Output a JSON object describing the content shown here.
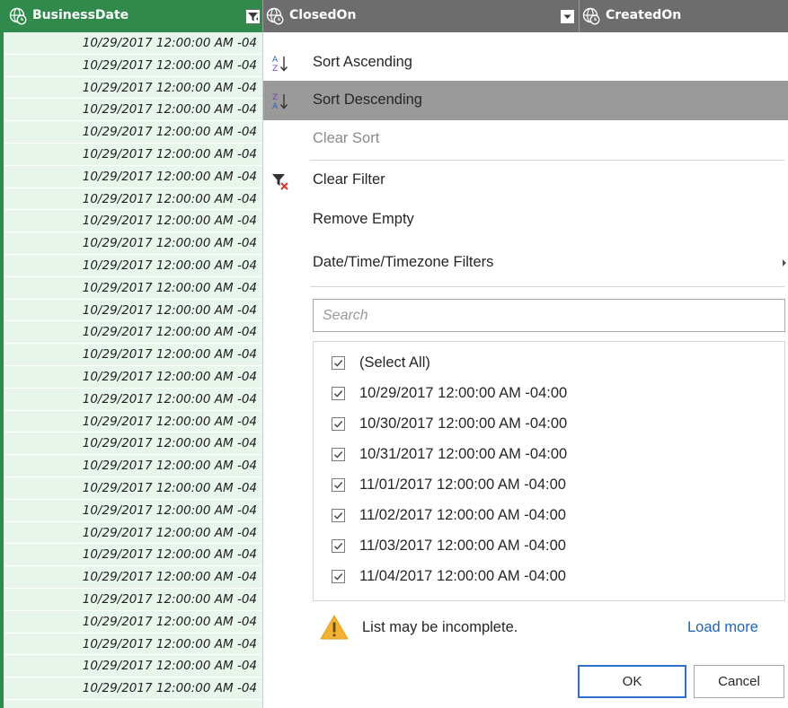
{
  "header": {
    "columns": [
      {
        "label": "BusinessDate",
        "icon": "globe-clock-icon"
      },
      {
        "label": "ClosedOn",
        "icon": "globe-clock-icon"
      },
      {
        "label": "CreatedOn",
        "icon": "globe-clock-icon"
      }
    ]
  },
  "column_values": [
    "10/29/2017 12:00:00 AM -04",
    "10/29/2017 12:00:00 AM -04",
    "10/29/2017 12:00:00 AM -04",
    "10/29/2017 12:00:00 AM -04",
    "10/29/2017 12:00:00 AM -04",
    "10/29/2017 12:00:00 AM -04",
    "10/29/2017 12:00:00 AM -04",
    "10/29/2017 12:00:00 AM -04",
    "10/29/2017 12:00:00 AM -04",
    "10/29/2017 12:00:00 AM -04",
    "10/29/2017 12:00:00 AM -04",
    "10/29/2017 12:00:00 AM -04",
    "10/29/2017 12:00:00 AM -04",
    "10/29/2017 12:00:00 AM -04",
    "10/29/2017 12:00:00 AM -04",
    "10/29/2017 12:00:00 AM -04",
    "10/29/2017 12:00:00 AM -04",
    "10/29/2017 12:00:00 AM -04",
    "10/29/2017 12:00:00 AM -04",
    "10/29/2017 12:00:00 AM -04",
    "10/29/2017 12:00:00 AM -04",
    "10/29/2017 12:00:00 AM -04",
    "10/29/2017 12:00:00 AM -04",
    "10/29/2017 12:00:00 AM -04",
    "10/29/2017 12:00:00 AM -04",
    "10/29/2017 12:00:00 AM -04",
    "10/29/2017 12:00:00 AM -04",
    "10/29/2017 12:00:00 AM -04",
    "10/29/2017 12:00:00 AM -04",
    "10/29/2017 12:00:00 AM -04"
  ],
  "menu": {
    "sort_ascending": "Sort Ascending",
    "sort_descending": "Sort Descending",
    "clear_sort": "Clear Sort",
    "clear_filter": "Clear Filter",
    "remove_empty": "Remove Empty",
    "date_filters": "Date/Time/Timezone Filters",
    "search_placeholder": "Search",
    "highlighted_item": "Sort Descending"
  },
  "checklist": [
    {
      "label": "(Select All)",
      "checked": true
    },
    {
      "label": "10/29/2017 12:00:00 AM -04:00",
      "checked": true
    },
    {
      "label": "10/30/2017 12:00:00 AM -04:00",
      "checked": true
    },
    {
      "label": "10/31/2017 12:00:00 AM -04:00",
      "checked": true
    },
    {
      "label": "11/01/2017 12:00:00 AM -04:00",
      "checked": true
    },
    {
      "label": "11/02/2017 12:00:00 AM -04:00",
      "checked": true
    },
    {
      "label": "11/03/2017 12:00:00 AM -04:00",
      "checked": true
    },
    {
      "label": "11/04/2017 12:00:00 AM -04:00",
      "checked": true
    }
  ],
  "footer": {
    "warning": "List may be incomplete.",
    "load_more": "Load more",
    "ok": "OK",
    "cancel": "Cancel"
  },
  "colors": {
    "header_bg": "#6d6d6d",
    "selected_column": "#2f8a4c",
    "column_fill": "#e8f5ea",
    "highlight": "#9a9a9a",
    "link": "#1f63b8",
    "warning": "#f2b233"
  }
}
